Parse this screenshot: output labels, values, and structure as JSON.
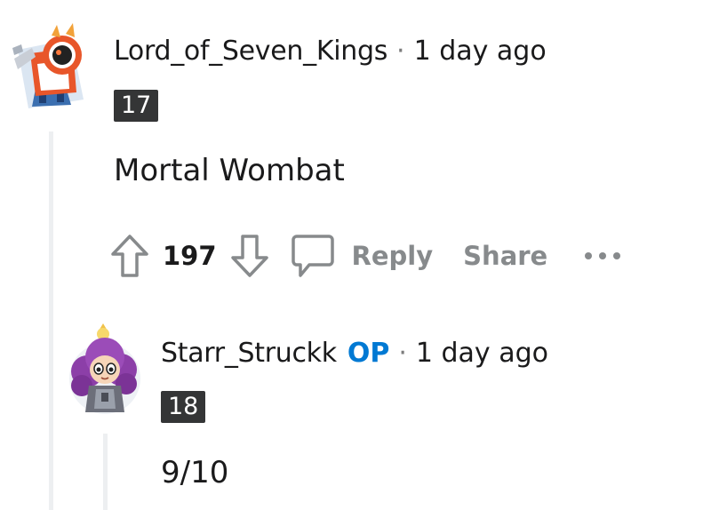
{
  "comments": [
    {
      "username": "Lord_of_Seven_Kings",
      "separator": "·",
      "timestamp": "1 day ago",
      "flair": "17",
      "body": "Mortal Wombat",
      "score": "197",
      "reply_label": "Reply",
      "share_label": "Share",
      "avatar_icon": "robot-avatar-icon"
    },
    {
      "username": "Starr_Struckk",
      "op_badge": "OP",
      "separator": "·",
      "timestamp": "1 day ago",
      "flair": "18",
      "body": "9/10",
      "avatar_icon": "purple-hair-avatar-icon"
    }
  ],
  "colors": {
    "op": "#0079d3",
    "flair_bg": "#343536",
    "action_text": "#878a8c",
    "thread_line": "#edeff1"
  }
}
